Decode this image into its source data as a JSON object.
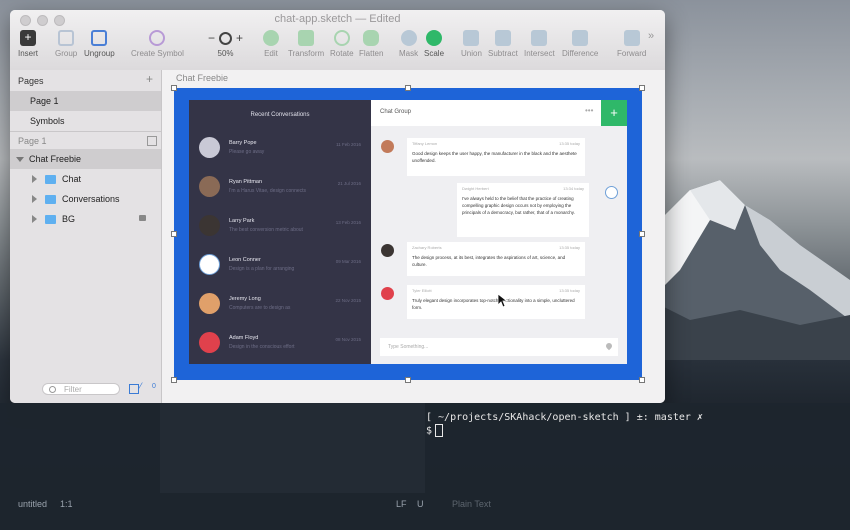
{
  "window": {
    "title": "chat-app.sketch — Edited",
    "toolbar": [
      {
        "label": "Insert",
        "icon": "insert-icon"
      },
      {
        "label": "Group",
        "icon": "group-icon"
      },
      {
        "label": "Ungroup",
        "icon": "ungroup-icon"
      },
      {
        "label": "Create Symbol",
        "icon": "symbol-icon"
      },
      {
        "label": "50%",
        "icon": "zoom-icon"
      },
      {
        "label": "Edit",
        "icon": "edit-icon"
      },
      {
        "label": "Transform",
        "icon": "transform-icon"
      },
      {
        "label": "Rotate",
        "icon": "rotate-icon"
      },
      {
        "label": "Flatten",
        "icon": "flatten-icon"
      },
      {
        "label": "Mask",
        "icon": "mask-icon"
      },
      {
        "label": "Scale",
        "icon": "scale-icon"
      },
      {
        "label": "Union",
        "icon": "union-icon"
      },
      {
        "label": "Subtract",
        "icon": "subtract-icon"
      },
      {
        "label": "Intersect",
        "icon": "intersect-icon"
      },
      {
        "label": "Difference",
        "icon": "difference-icon"
      },
      {
        "label": "Forward",
        "icon": "forward-icon"
      }
    ],
    "zoom_minus": "−",
    "zoom_plus": "+",
    "overflow": "»"
  },
  "sidebar": {
    "pages_header": "Pages",
    "pages": [
      "Page 1",
      "Symbols"
    ],
    "current_page": "Page 1",
    "layers": [
      {
        "label": "Chat Freebie",
        "type": "artboard"
      },
      {
        "label": "Chat",
        "type": "folder"
      },
      {
        "label": "Conversations",
        "type": "folder"
      },
      {
        "label": "BG",
        "type": "folder",
        "locked": true
      }
    ],
    "filter_placeholder": "Filter",
    "filter_count": "0"
  },
  "canvas": {
    "artboard_label": "Chat Freebie",
    "artboard_color": "#1e64d8"
  },
  "chat": {
    "left_header": "Recent Conversations",
    "conversations": [
      {
        "name": "Barry Pope",
        "message": "Please go away",
        "date": "11 Feb 2016",
        "avatar_color": "#c9c9d6"
      },
      {
        "name": "Ryan Pittman",
        "message": "I'm a Harus Vitae, design connects",
        "date": "21 Jul 2016",
        "avatar_color": "#8a6a56"
      },
      {
        "name": "Larry Park",
        "message": "The best conversion metric about",
        "date": "13 Feb 2016",
        "avatar_color": "#3b3533"
      },
      {
        "name": "Leon Conner",
        "message": "Design is a plan for arranging",
        "date": "09 Mar 2016",
        "avatar_color": "#ffffff"
      },
      {
        "name": "Jeremy Long",
        "message": "Computers are to design as",
        "date": "22 Nov 2015",
        "avatar_color": "#e0a06a"
      },
      {
        "name": "Adam Floyd",
        "message": "Design in the conscious effort",
        "date": "08 Nov 2015",
        "avatar_color": "#e0414c"
      }
    ],
    "group_title": "Chat Group",
    "more": "•••",
    "add": "+",
    "messages": [
      {
        "sender": "Tiffany Lemon",
        "time": "13:35 today",
        "text": "Good design keeps the user happy, the manufacturer in the black and the aesthete unoffended."
      },
      {
        "sender": "Dwight Herbert",
        "time": "13:34 today",
        "text": "I've always held to the belief that the practice of creating compelling graphic design occurs not by employing the principals of a democracy, but rather, that of a monarchy."
      },
      {
        "sender": "Zachary Roberts",
        "time": "13:35 today",
        "text": "The design process, at its best, integrates the aspirations of art, science, and culture."
      },
      {
        "sender": "Tyler Elliott",
        "time": "13:35 today",
        "text": "Truly elegant design incorporates top-notch functionality into a simple, uncluttered form."
      }
    ],
    "input_placeholder": "Type Something..."
  },
  "terminal": {
    "prompt_line": "[ ~/projects/SKAhack/open-sketch ] ±: master ✗",
    "prompt_symbol": "$"
  },
  "statusbar": {
    "file": "untitled",
    "position": "1:1",
    "line_ending": "LF",
    "encoding": "U",
    "grammar": "Plain Text"
  }
}
